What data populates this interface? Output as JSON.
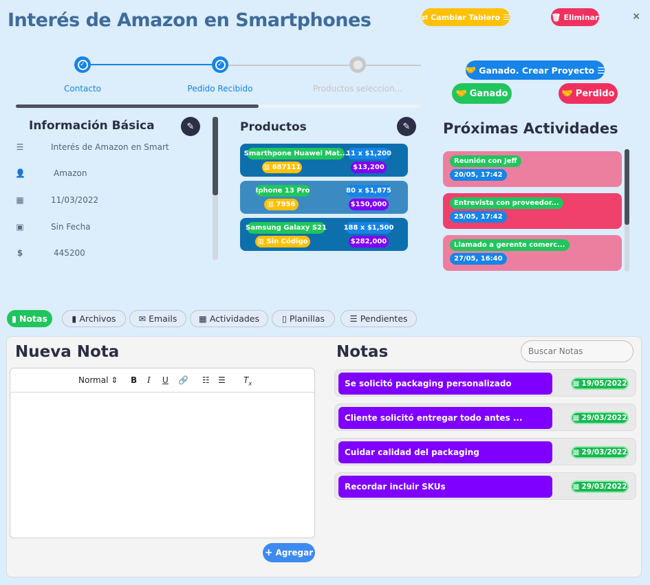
{
  "header": {
    "title": "Interés de Amazon en Smartphones",
    "change_board_label": "Cambiar Tablero",
    "delete_label": "Eliminar",
    "close_label": "×"
  },
  "stepper": {
    "steps": [
      {
        "label": "Contacto",
        "state": "done"
      },
      {
        "label": "Pedido Recibido",
        "state": "done"
      },
      {
        "label": "Productos seleccion...",
        "state": "pending"
      }
    ],
    "progress": 0.6
  },
  "outcome": {
    "won_create_label": "Ganado. Crear Proyecto",
    "won_label": "Ganado",
    "lost_label": "Perdido"
  },
  "info": {
    "heading": "Información Básica",
    "rows": [
      {
        "icon": "list-icon",
        "value": "Interés de Amazon en Smart"
      },
      {
        "icon": "contact-icon",
        "value": "Amazon"
      },
      {
        "icon": "calendar-icon",
        "value": "11/03/2022"
      },
      {
        "icon": "calendar-check-icon",
        "value": "Sin Fecha"
      },
      {
        "icon": "dollar-icon",
        "value": "445200"
      }
    ]
  },
  "products": {
    "heading": "Productos",
    "items": [
      {
        "name": "Smarthpone Huawei Mat...",
        "code": "687111",
        "qty_price": "11 x $1,200",
        "total": "$13,200"
      },
      {
        "name": "Iphone 13 Pro",
        "code": "7956",
        "qty_price": "80 x $1,875",
        "total": "$150,000"
      },
      {
        "name": "Samsung Galaxy S21",
        "code": "Sin Código",
        "qty_price": "188 x $1,500",
        "total": "$282,000"
      }
    ]
  },
  "activities": {
    "heading": "Próximas Actividades",
    "items": [
      {
        "title": "Reunión con Jeff",
        "date": "20/05, 17:42"
      },
      {
        "title": "Entrevista con proveedor...",
        "date": "25/05, 17:42"
      },
      {
        "title": "Llamado a gerente comerc...",
        "date": "27/05, 16:40"
      }
    ]
  },
  "tabs": [
    {
      "label": "Notas",
      "icon": "clipboard-icon",
      "active": true
    },
    {
      "label": "Archivos",
      "icon": "file-icon",
      "active": false
    },
    {
      "label": "Emails",
      "icon": "envelope-icon",
      "active": false
    },
    {
      "label": "Actividades",
      "icon": "calendar-icon",
      "active": false
    },
    {
      "label": "Planillas",
      "icon": "sheet-icon",
      "active": false
    },
    {
      "label": "Pendientes",
      "icon": "checklist-icon",
      "active": false
    }
  ],
  "new_note": {
    "heading": "Nueva Nota",
    "format_select": "Normal",
    "add_label": "Agregar"
  },
  "notes": {
    "heading": "Notas",
    "search_placeholder": "Buscar Notas",
    "items": [
      {
        "title": "Se solicitó packaging personalizado",
        "date": "19/05/2022"
      },
      {
        "title": "Cliente solicitó entregar todo antes ...",
        "date": "29/03/2022"
      },
      {
        "title": "Cuidar calidad del packaging",
        "date": "29/03/2022"
      },
      {
        "title": "Recordar incluir SKUs",
        "date": "29/03/2022"
      }
    ]
  },
  "colors": {
    "title": "#3e6b9c",
    "yellow": "#ffc107",
    "red": "#f0305e",
    "blue": "#1684e8",
    "green": "#21c55d",
    "purple": "#7f00ff",
    "product_bg": "#0e6fad",
    "activity_pink": "#ec7fa0"
  }
}
